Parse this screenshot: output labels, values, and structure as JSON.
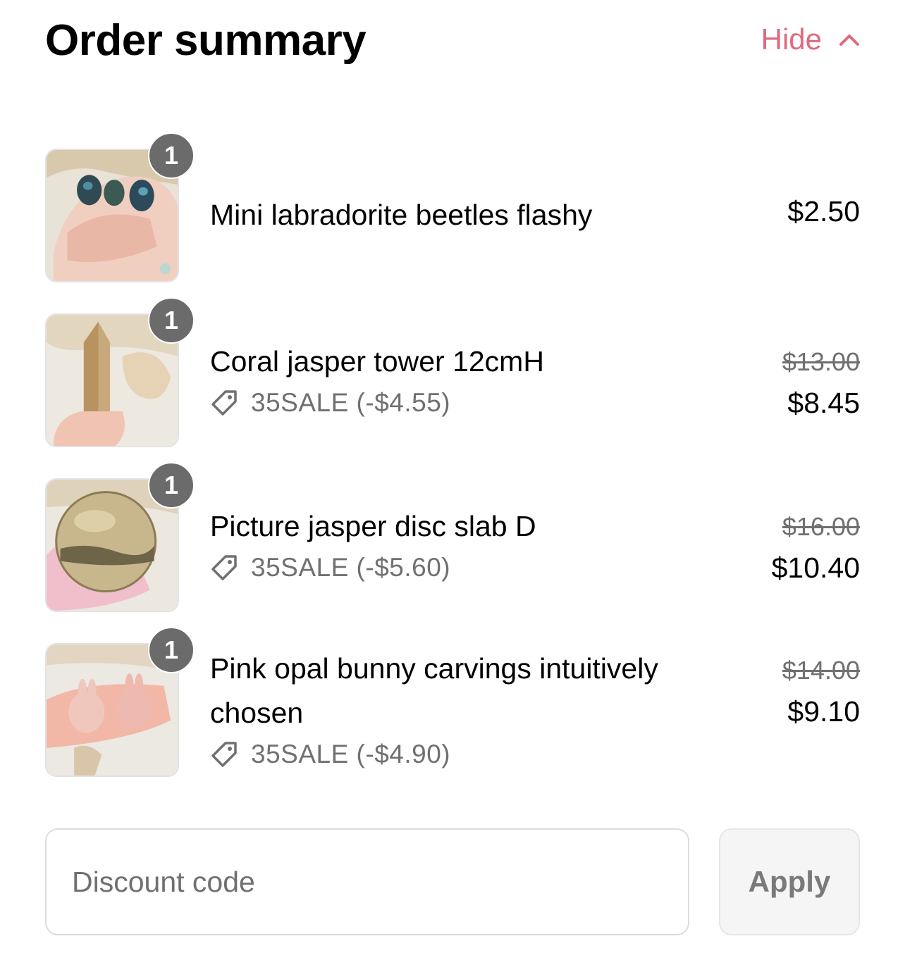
{
  "header": {
    "title": "Order summary",
    "toggle_label": "Hide",
    "accent_color": "#e0697e"
  },
  "items": [
    {
      "quantity": "1",
      "name": "Mini labradorite beetles flashy",
      "price": "$2.50",
      "thumbnail": "labradorite-beetles-photo"
    },
    {
      "quantity": "1",
      "name": "Coral jasper tower 12cmH",
      "original_price": "$13.00",
      "price": "$8.45",
      "discount": "35SALE (-$4.55)",
      "thumbnail": "coral-jasper-tower-photo"
    },
    {
      "quantity": "1",
      "name": "Picture jasper disc slab D",
      "original_price": "$16.00",
      "price": "$10.40",
      "discount": "35SALE (-$5.60)",
      "thumbnail": "picture-jasper-disc-photo"
    },
    {
      "quantity": "1",
      "name_line1": "Pink opal bunny carvings intuitively",
      "name_line2": "chosen",
      "original_price": "$14.00",
      "price": "$9.10",
      "discount": "35SALE (-$4.90)",
      "thumbnail": "pink-opal-bunnies-photo"
    }
  ],
  "discount_form": {
    "placeholder": "Discount code",
    "apply_label": "Apply"
  }
}
